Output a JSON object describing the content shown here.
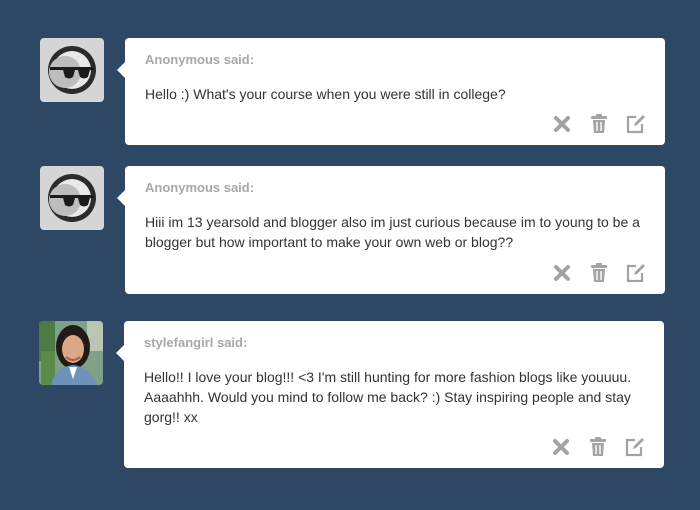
{
  "asks": [
    {
      "asker": "Anonymous said:",
      "question": "Hello :) What's your course when you were still in college?",
      "avatar": "anonymous-sunglasses-icon"
    },
    {
      "asker": "Anonymous said:",
      "question": "Hiii im 13 yearsold and blogger also im just curious because im to young to be a blogger but how important to make your own web or blog??",
      "avatar": "anonymous-sunglasses-icon"
    },
    {
      "asker": "stylefangirl said:",
      "question": "Hello!! I love your blog!!! <3 I'm still hunting for more fashion blogs like youuuu. Aaaahhh. Would you mind to follow me back? :) Stay inspiring people and stay gorg!! xx",
      "avatar": "user-photo"
    }
  ],
  "actions": [
    "delete-x-icon",
    "trash-icon",
    "edit-icon"
  ],
  "colors": {
    "background": "#2e4765",
    "bubble": "#ffffff",
    "asker_text": "#a8a8a8",
    "question_text": "#333333",
    "action_icon": "#a3a3a3"
  }
}
